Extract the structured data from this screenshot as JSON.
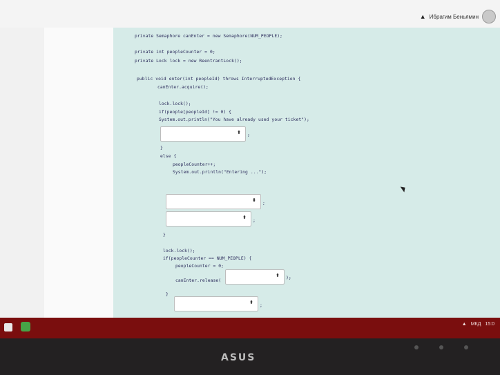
{
  "header": {
    "user_name": "Ибрагим Беньямин",
    "bell_icon": "bell-icon"
  },
  "code": {
    "l1": "private Semaphore canEnter = new Semaphore(NUM_PEOPLE);",
    "l2": "private int peopleCounter = 0;",
    "l3": "private Lock lock = new ReentrantLock();",
    "l4": "public void enter(int peopleId) throws InterruptedException {",
    "l5": "canEnter.acquire();",
    "l6": "lock.lock();",
    "l7": "if(people[peopleId] != 0) {",
    "l8": "System.out.println(\"You have already used your ticket\");",
    "l9": "}",
    "l10": "else {",
    "l11": "peopleCounter++;",
    "l12": "System.out.println(\"Entering ...\");",
    "l13": "}",
    "l14": "lock.lock();",
    "l15": "if(peopleCounter == NUM_PEOPLE) {",
    "l16": "peopleCounter = 0;",
    "l17": "canEnter.release(",
    "l18": "}",
    "l19": "}",
    "semicolon": ";",
    "close_paren_semicolon": ");"
  },
  "dropdowns": {
    "arrow_glyph": "⬍",
    "d1": "",
    "d2": "",
    "d3": "",
    "d4": "",
    "d5": ""
  },
  "taskbar": {
    "lang": "МКД",
    "time": "15:0"
  },
  "bezel": {
    "brand": "ASUS"
  }
}
